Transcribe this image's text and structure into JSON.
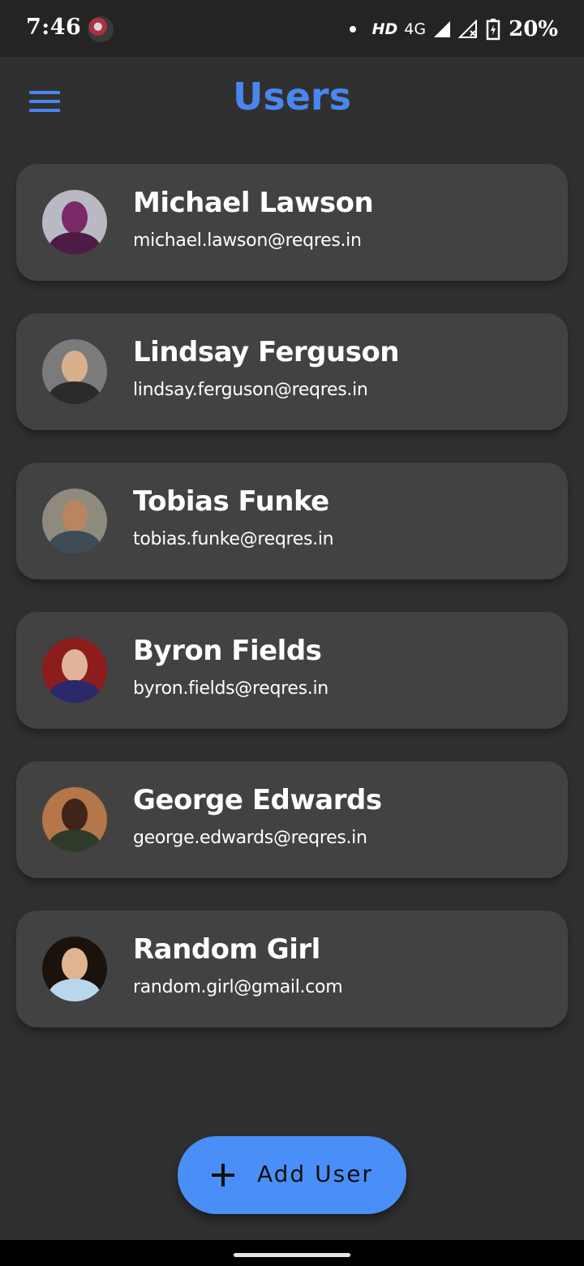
{
  "status_bar": {
    "time": "7:46",
    "hd": "HD",
    "network": "4G",
    "battery": "20%"
  },
  "app_bar": {
    "title": "Users",
    "menu_icon": "hamburger-menu-icon"
  },
  "users": [
    {
      "name": "Michael Lawson",
      "email": "michael.lawson@reqres.in",
      "avatar_colors": [
        "#b9b9c3",
        "#7a2a66",
        "#4c1c46"
      ]
    },
    {
      "name": "Lindsay Ferguson",
      "email": "lindsay.ferguson@reqres.in",
      "avatar_colors": [
        "#7b7b7b",
        "#d8b08e",
        "#2b2b2b"
      ]
    },
    {
      "name": "Tobias Funke",
      "email": "tobias.funke@reqres.in",
      "avatar_colors": [
        "#8f8a7e",
        "#b88461",
        "#3d4b57"
      ]
    },
    {
      "name": "Byron Fields",
      "email": "byron.fields@reqres.in",
      "avatar_colors": [
        "#8d1c1c",
        "#e1b39a",
        "#2a2a6b"
      ]
    },
    {
      "name": "George Edwards",
      "email": "george.edwards@reqres.in",
      "avatar_colors": [
        "#b5764a",
        "#3f2418",
        "#2f3b2a"
      ]
    },
    {
      "name": "Random Girl",
      "email": "random.girl@gmail.com",
      "avatar_colors": [
        "#1a120c",
        "#e0b48f",
        "#b9d7ea"
      ]
    }
  ],
  "fab": {
    "label": "Add User",
    "icon": "plus-icon",
    "color": "#4a8ff7"
  },
  "colors": {
    "accent": "#4a86f0",
    "background": "#303030",
    "card": "#424242"
  }
}
